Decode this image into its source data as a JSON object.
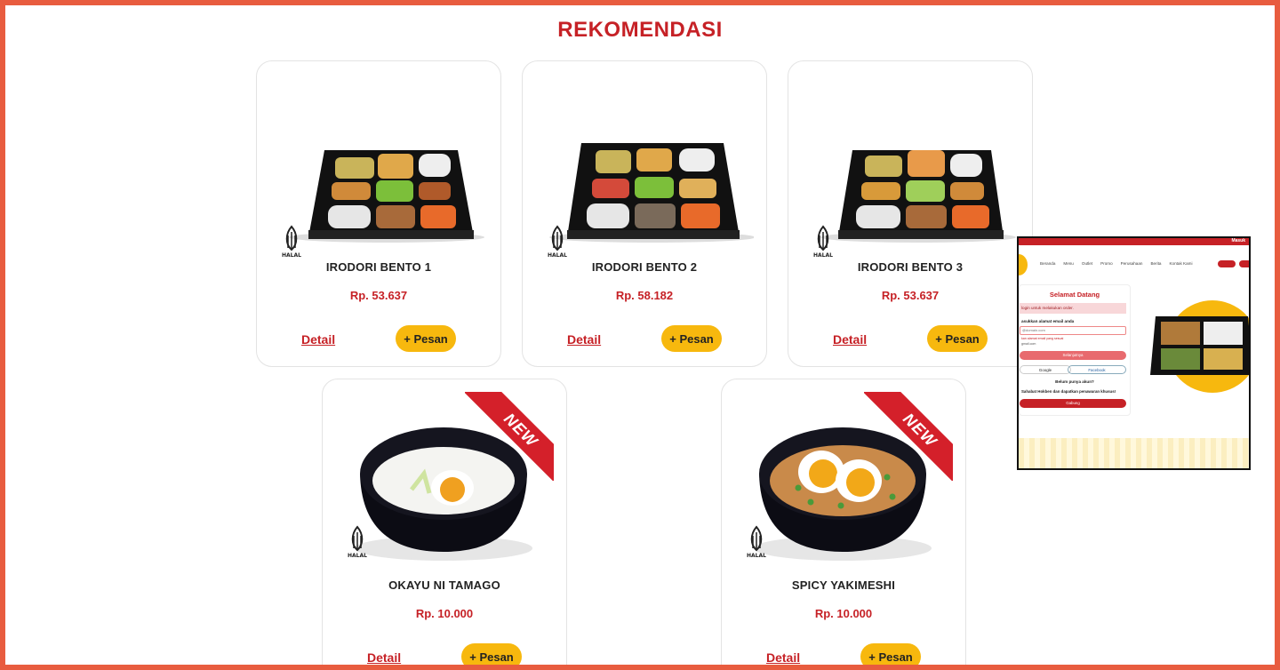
{
  "section_title": "REKOMENDASI",
  "products": [
    {
      "name": "IRODORI BENTO 1",
      "price": "Rp. 53.637",
      "detail_label": "Detail",
      "order_label": "+ Pesan",
      "halal_label": "HALAL"
    },
    {
      "name": "IRODORI BENTO 2",
      "price": "Rp. 58.182",
      "detail_label": "Detail",
      "order_label": "+ Pesan",
      "halal_label": "HALAL"
    },
    {
      "name": "IRODORI BENTO 3",
      "price": "Rp. 53.637",
      "detail_label": "Detail",
      "order_label": "+ Pesan",
      "halal_label": "HALAL"
    },
    {
      "name": "OKAYU NI TAMAGO",
      "price": "Rp. 10.000",
      "detail_label": "Detail",
      "order_label": "+ Pesan",
      "badge": "NEW",
      "halal_label": "HALAL"
    },
    {
      "name": "SPICY YAKIMESHI",
      "price": "Rp. 10.000",
      "detail_label": "Detail",
      "order_label": "+ Pesan",
      "badge": "NEW",
      "halal_label": "HALAL"
    }
  ],
  "preview": {
    "topbar_label": "Masuk",
    "nav": [
      "Beranda",
      "Menu",
      "Outlet",
      "Promo",
      "Perusahaan",
      "Berita",
      "Kontak Kami"
    ],
    "login_title": "Selamat Datang",
    "login_warning": "login untuk melakukan order.",
    "email_label": "asukkan alamat email anda",
    "email_placeholder": "@domain.com",
    "email_error": "kan alamat email yang sesuai",
    "email_hint": "gmail.com",
    "next_label": "Selanjutnya",
    "google_label": "Google",
    "facebook_label": "Facebook",
    "no_account": "Belum punya akun?",
    "join_text": "Sahabat Hokben dan dapatkan penawaran khusus!",
    "join_label": "Gabung"
  },
  "colors": {
    "brand_red": "#c62126",
    "accent_yellow": "#f7b80e",
    "frame": "#e85c3f"
  }
}
